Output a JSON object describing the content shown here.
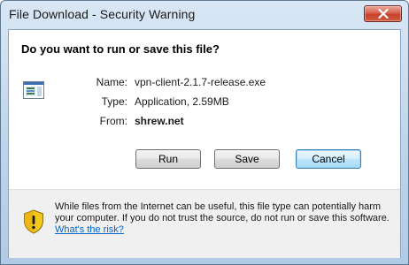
{
  "window": {
    "title": "File Download - Security Warning"
  },
  "dialog": {
    "heading": "Do you want to run or save this file?",
    "file": {
      "name_label": "Name:",
      "name_value": "vpn-client-2.1.7-release.exe",
      "type_label": "Type:",
      "type_value": "Application, 2.59MB",
      "from_label": "From:",
      "from_value": "shrew.net"
    },
    "buttons": {
      "run": "Run",
      "save": "Save",
      "cancel": "Cancel"
    },
    "warning": {
      "text": "While files from the Internet can be useful, this file type can potentially harm your computer. If you do not trust the source, do not run or save this software. ",
      "link": "What's the risk?"
    }
  },
  "icons": {
    "close": "close-icon",
    "file": "application-file-icon",
    "shield": "security-shield-icon"
  },
  "colors": {
    "close_button": "#c8402b",
    "link": "#0066cc",
    "default_button_border": "#3c7fb1",
    "shield_yellow": "#f2c81c"
  }
}
